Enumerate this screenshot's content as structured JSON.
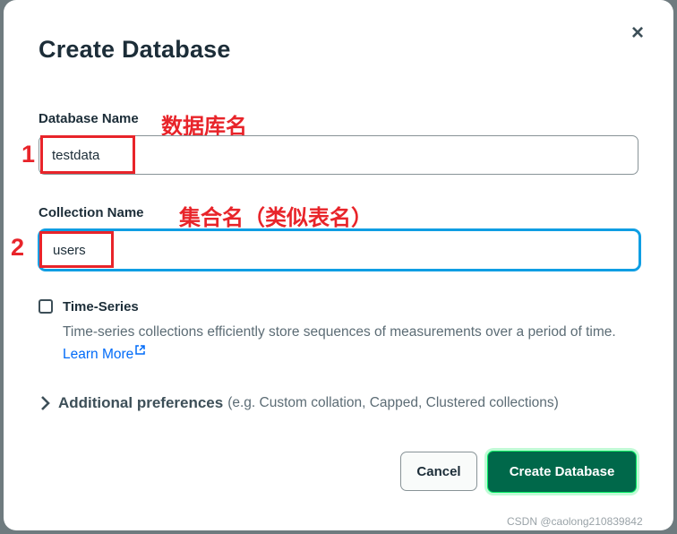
{
  "dialog": {
    "title": "Create Database",
    "close_icon": "close-icon"
  },
  "fields": {
    "database_name": {
      "label": "Database Name",
      "value": "testdata",
      "annotation": "数据库名",
      "marker": "1"
    },
    "collection_name": {
      "label": "Collection Name",
      "value": "users",
      "annotation": "集合名（类似表名）",
      "marker": "2"
    }
  },
  "time_series": {
    "label": "Time-Series",
    "checked": false,
    "description": "Time-series collections efficiently store sequences of measurements over a period of time.",
    "learn_more": "Learn More",
    "external_icon": "external-link-icon"
  },
  "additional": {
    "title": "Additional preferences",
    "note": "(e.g. Custom collation, Capped, Clustered collections)",
    "icon": "chevron-right-icon"
  },
  "buttons": {
    "cancel": "Cancel",
    "create": "Create Database"
  },
  "watermark": "CSDN @caolong210839842",
  "colors": {
    "accent_blue": "#0f9ee3",
    "annotation_red": "#e8242a",
    "primary_green": "#00684a"
  }
}
